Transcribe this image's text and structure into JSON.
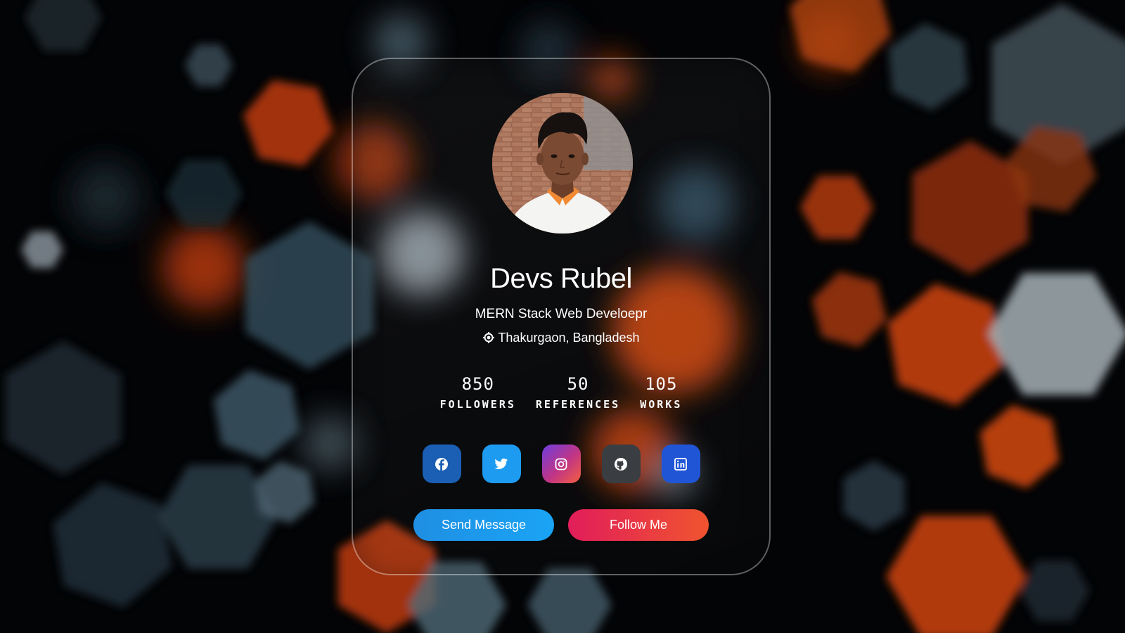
{
  "profile": {
    "name": "Devs Rubel",
    "role": "MERN Stack Web Develoepr",
    "location": "Thakurgaon, Bangladesh",
    "location_icon": "location-pin-icon"
  },
  "stats": [
    {
      "value": "850",
      "label": "FOLLOWERS"
    },
    {
      "value": "50",
      "label": "REFERENCES"
    },
    {
      "value": "105",
      "label": "WORKS"
    }
  ],
  "socials": [
    {
      "name": "facebook-icon",
      "color": "#1a5fb4"
    },
    {
      "name": "twitter-icon",
      "color": "#1d9bf0"
    },
    {
      "name": "instagram-icon",
      "color": "#c13584"
    },
    {
      "name": "github-icon",
      "color": "#3a3d42"
    },
    {
      "name": "linkedin-icon",
      "color": "#2055d6"
    }
  ],
  "actions": {
    "send_message": "Send Message",
    "follow_me": "Follow Me"
  },
  "colors": {
    "accent_orange": "#e0460a",
    "accent_slate": "#3b4f5c"
  }
}
